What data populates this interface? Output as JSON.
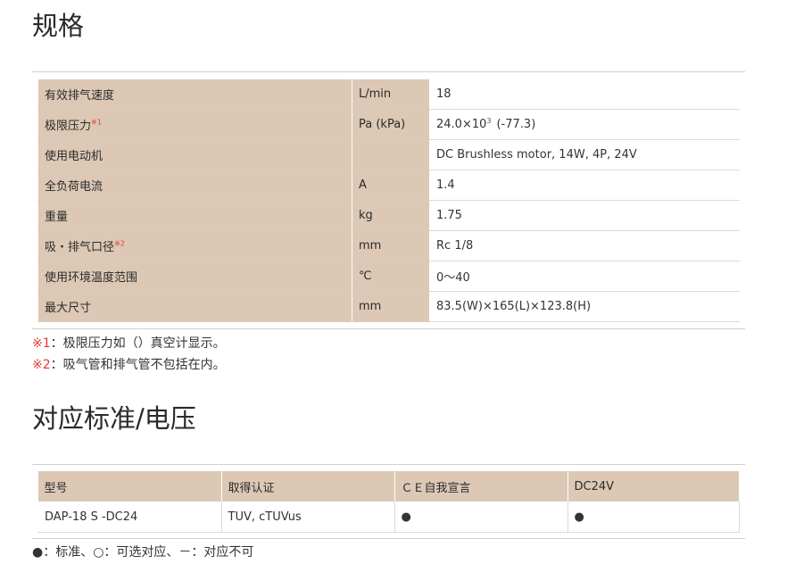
{
  "spec_section": {
    "title": "规格",
    "rows": [
      {
        "label": "有效排气速度",
        "mark": "",
        "unit": "L/min",
        "value": "18"
      },
      {
        "label": "极限压力",
        "mark": "※1",
        "unit": "Pa (kPa)",
        "value_pre": "24.0×10",
        "value_exp": "3",
        "value_post": "(-77.3)"
      },
      {
        "label": "使用电动机",
        "mark": "",
        "unit": "",
        "value": "DC Brushless motor, 14W, 4P, 24V"
      },
      {
        "label": "全负荷电流",
        "mark": "",
        "unit": "A",
        "value": "1.4"
      },
      {
        "label": "重量",
        "mark": "",
        "unit": "kg",
        "value": "1.75"
      },
      {
        "label": "吸・排气口径",
        "mark": "※2",
        "unit": "mm",
        "value": "Rc 1/8"
      },
      {
        "label": "使用环境温度范围",
        "mark": "",
        "unit": "℃",
        "value": "0～40"
      },
      {
        "label": "最大尺寸",
        "mark": "",
        "unit": "mm",
        "value": "83.5(W)×165(L)×123.8(H)"
      }
    ],
    "notes": [
      {
        "mark": "※1",
        "text": "：极限压力如（）真空计显示。"
      },
      {
        "mark": "※2",
        "text": "：吸气管和排气管不包括在内。"
      }
    ]
  },
  "standards_section": {
    "title": "对应标准/电压",
    "headers": [
      "型号",
      "取得认证",
      "ＣＥ自我宣言",
      "DC24V"
    ],
    "row": [
      "DAP-18 S -DC24",
      "TUV, cTUVus",
      "●",
      "●"
    ],
    "legend": "●：标准、○：可选对应、－：对应不可"
  },
  "colors": {
    "header_bg": "#dcc8b5",
    "note_mark": "#e53935"
  }
}
